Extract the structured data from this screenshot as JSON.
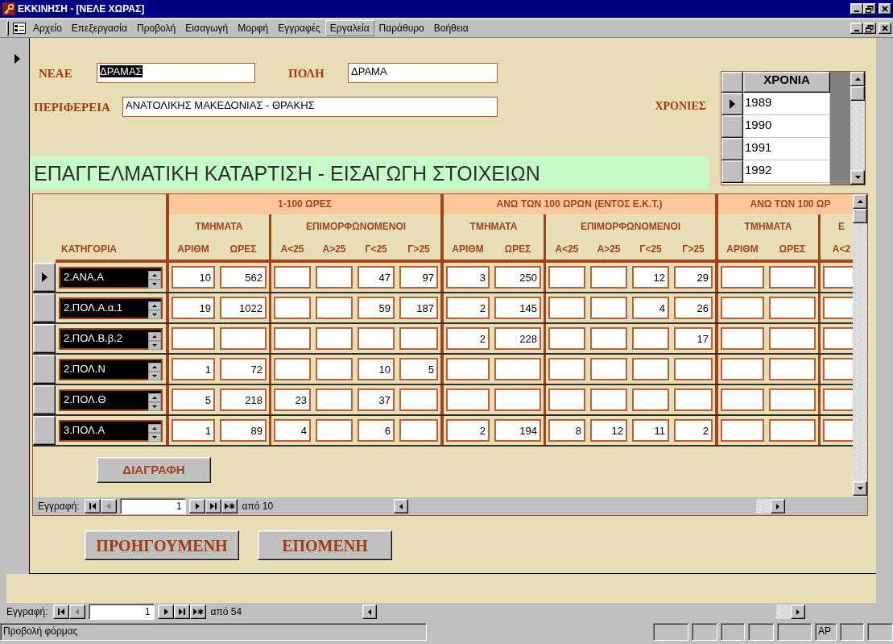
{
  "window": {
    "title": "ΕΚΚΙΝΗΣΗ - [ΝΕΛΕ ΧΩΡΑΣ]"
  },
  "menu": [
    {
      "label": "Αρχείο",
      "selected": false
    },
    {
      "label": "Επεξεργασία",
      "selected": false
    },
    {
      "label": "Προβολή",
      "selected": false
    },
    {
      "label": "Εισαγωγή",
      "selected": false
    },
    {
      "label": "Μορφή",
      "selected": false
    },
    {
      "label": "Εγγραφές",
      "selected": false
    },
    {
      "label": "Εργαλεία",
      "selected": true
    },
    {
      "label": "Παράθυρο",
      "selected": false
    },
    {
      "label": "Βοήθεια",
      "selected": false
    }
  ],
  "form": {
    "current_record": true,
    "fields": [
      {
        "label": "ΝΕΑΕ",
        "value": "ΔΡΑΜΑΣ",
        "text_selected": true
      },
      {
        "label": "ΠΟΛΗ",
        "value": "ΔΡΑΜΑ",
        "text_selected": false
      },
      {
        "label": "ΠΕΡΙΦΕΡΕΙΑ",
        "value": "ΑΝΑΤΟΛΙΚΗΣ ΜΑΚΕΔΟΝΙΑΣ - ΘΡΑΚΗΣ",
        "text_selected": false
      }
    ],
    "years": {
      "label": "ΧΡΟΝΙΕΣ",
      "column": "ΧΡΟΝΙΑ",
      "rows": [
        {
          "value": "1989",
          "current": true
        },
        {
          "value": "1990",
          "current": false
        },
        {
          "value": "1991",
          "current": false
        },
        {
          "value": "1992",
          "current": false
        }
      ]
    },
    "heading": "ΕΠΑΓΓΕΛΜΑΤΙΚΗ ΚΑΤΑΡΤΙΣΗ - ΕΙΣΑΓΩΓΗ ΣΤΟΙΧΕΙΩΝ",
    "subform": {
      "category_header": "ΚΑΤΗΓΟΡΙΑ",
      "groups": [
        {
          "title": "1-100 ΩΡΕΣ",
          "subgroups": [
            {
              "title": "ΤΜΗΜΑΤΑ",
              "columns": [
                "ΑΡΙΘΜ",
                "ΩΡΕΣ"
              ]
            },
            {
              "title": "ΕΠΙΜΟΡΦΩΝΟΜΕΝΟΙ",
              "columns": [
                "Α<25",
                "Α>25",
                "Γ<25",
                "Γ>25"
              ]
            }
          ]
        },
        {
          "title": "ΑΝΩ ΤΩΝ 100 ΩΡΩΝ (ΕΝΤΟΣ Ε.Κ.Τ.)",
          "subgroups": [
            {
              "title": "ΤΜΗΜΑΤΑ",
              "columns": [
                "ΑΡΙΘΜ",
                "ΩΡΕΣ"
              ]
            },
            {
              "title": "ΕΠΙΜΟΡΦΩΝΟΜΕΝΟΙ",
              "columns": [
                "Α<25",
                "Α>25",
                "Γ<25",
                "Γ>25"
              ]
            }
          ]
        },
        {
          "title": "ΑΝΩ ΤΩΝ 100 ΩΡ",
          "subgroups": [
            {
              "title": "ΤΜΗΜΑΤΑ",
              "columns": [
                "ΑΡΙΘΜ",
                "ΩΡΕΣ"
              ]
            },
            {
              "title": "Ε",
              "columns": [
                "Α<2"
              ]
            }
          ]
        }
      ],
      "rows": [
        {
          "category": "2.ΑΝΑ.Α",
          "current": true,
          "cells": [
            {
              "kind": "filled",
              "text": "10"
            },
            {
              "kind": "filled",
              "text": "562"
            },
            {
              "kind": "blank"
            },
            {
              "kind": "blank"
            },
            {
              "kind": "filled",
              "text": "47"
            },
            {
              "kind": "filled",
              "text": "97"
            },
            {
              "kind": "filled",
              "text": "3"
            },
            {
              "kind": "filled",
              "text": "250"
            },
            {
              "kind": "blank"
            },
            {
              "kind": "blank"
            },
            {
              "kind": "filled",
              "text": "12"
            },
            {
              "kind": "filled",
              "text": "29"
            },
            {
              "kind": "blank"
            },
            {
              "kind": "blank"
            },
            {
              "kind": "blank"
            }
          ]
        },
        {
          "category": "2.ΠΟΛ.Α.α.1",
          "current": false,
          "cells": [
            {
              "kind": "filled",
              "text": "19"
            },
            {
              "kind": "filled",
              "text": "1022"
            },
            {
              "kind": "blank"
            },
            {
              "kind": "blank"
            },
            {
              "kind": "filled",
              "text": "59"
            },
            {
              "kind": "filled",
              "text": "187"
            },
            {
              "kind": "filled",
              "text": "2"
            },
            {
              "kind": "filled",
              "text": "145"
            },
            {
              "kind": "blank"
            },
            {
              "kind": "blank"
            },
            {
              "kind": "filled",
              "text": "4"
            },
            {
              "kind": "filled",
              "text": "26"
            },
            {
              "kind": "blank"
            },
            {
              "kind": "blank"
            },
            {
              "kind": "blank"
            }
          ]
        },
        {
          "category": "2.ΠΟΛ.Β.β.2",
          "current": false,
          "cells": [
            {
              "kind": "blank"
            },
            {
              "kind": "blank"
            },
            {
              "kind": "blank"
            },
            {
              "kind": "blank"
            },
            {
              "kind": "blank"
            },
            {
              "kind": "blank"
            },
            {
              "kind": "filled",
              "text": "2"
            },
            {
              "kind": "filled",
              "text": "228"
            },
            {
              "kind": "blank"
            },
            {
              "kind": "blank"
            },
            {
              "kind": "blank"
            },
            {
              "kind": "filled",
              "text": "17"
            },
            {
              "kind": "blank"
            },
            {
              "kind": "blank"
            },
            {
              "kind": "blank"
            }
          ]
        },
        {
          "category": "2.ΠΟΛ.Ν",
          "current": false,
          "cells": [
            {
              "kind": "filled",
              "text": "1"
            },
            {
              "kind": "filled",
              "text": "72"
            },
            {
              "kind": "blank"
            },
            {
              "kind": "blank"
            },
            {
              "kind": "filled",
              "text": "10"
            },
            {
              "kind": "filled",
              "text": "5"
            },
            {
              "kind": "blank"
            },
            {
              "kind": "blank"
            },
            {
              "kind": "blank"
            },
            {
              "kind": "blank"
            },
            {
              "kind": "blank"
            },
            {
              "kind": "blank"
            },
            {
              "kind": "blank"
            },
            {
              "kind": "blank"
            },
            {
              "kind": "blank"
            }
          ]
        },
        {
          "category": "2.ΠΟΛ.Θ",
          "current": false,
          "cells": [
            {
              "kind": "filled",
              "text": "5"
            },
            {
              "kind": "filled",
              "text": "218"
            },
            {
              "kind": "filled",
              "text": "23"
            },
            {
              "kind": "blank"
            },
            {
              "kind": "filled",
              "text": "37"
            },
            {
              "kind": "blank"
            },
            {
              "kind": "blank"
            },
            {
              "kind": "blank"
            },
            {
              "kind": "blank"
            },
            {
              "kind": "blank"
            },
            {
              "kind": "blank"
            },
            {
              "kind": "blank"
            },
            {
              "kind": "blank"
            },
            {
              "kind": "blank"
            },
            {
              "kind": "blank"
            }
          ]
        },
        {
          "category": "3.ΠΟΛ.Α",
          "current": false,
          "cells": [
            {
              "kind": "filled",
              "text": "1"
            },
            {
              "kind": "filled",
              "text": "89"
            },
            {
              "kind": "filled",
              "text": "4"
            },
            {
              "kind": "blank"
            },
            {
              "kind": "filled",
              "text": "6"
            },
            {
              "kind": "blank"
            },
            {
              "kind": "filled",
              "text": "2"
            },
            {
              "kind": "filled",
              "text": "194"
            },
            {
              "kind": "filled",
              "text": "8"
            },
            {
              "kind": "filled",
              "text": "12"
            },
            {
              "kind": "filled",
              "text": "11"
            },
            {
              "kind": "filled",
              "text": "2"
            },
            {
              "kind": "blank"
            },
            {
              "kind": "blank"
            },
            {
              "kind": "blank"
            }
          ]
        }
      ],
      "delete_button": "ΔΙΑΓΡΑΦΗ",
      "navigator": {
        "label": "Εγγραφή:",
        "record": "1",
        "total": "από 10",
        "buttons": [
          {
            "kind": "first",
            "disabled": false
          },
          {
            "kind": "previous",
            "disabled": true
          },
          {
            "kind": "next",
            "disabled": false
          },
          {
            "kind": "last",
            "disabled": false
          },
          {
            "kind": "new",
            "disabled": false
          }
        ]
      }
    },
    "buttons": [
      "ΠΡΟΗΓΟΥΜΕΝΗ",
      "ΕΠΟΜΕΝΗ"
    ]
  },
  "navigator": {
    "label": "Εγγραφή:",
    "record": "1",
    "total": "από 54",
    "buttons": [
      {
        "kind": "first",
        "disabled": false
      },
      {
        "kind": "previous",
        "disabled": true
      },
      {
        "kind": "next",
        "disabled": false
      },
      {
        "kind": "last",
        "disabled": false
      },
      {
        "kind": "new",
        "disabled": false
      }
    ]
  },
  "status_bar": {
    "text": "Προβολή φόρμας",
    "panes": [
      {
        "kind": "blank"
      },
      {
        "kind": "blank"
      },
      {
        "kind": "blank"
      },
      {
        "kind": "blank"
      },
      {
        "kind": "blank"
      },
      {
        "kind": "text",
        "text": "AP"
      },
      {
        "kind": "blank"
      },
      {
        "kind": "blank"
      }
    ]
  }
}
